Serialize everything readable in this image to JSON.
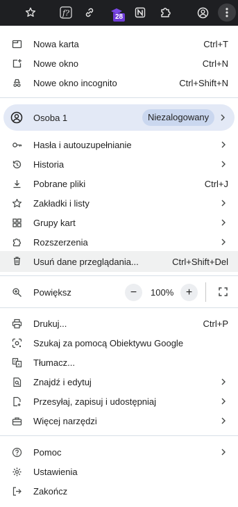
{
  "toolbar": {
    "badge": "28",
    "icons": [
      "star-icon",
      "font-extension-icon",
      "link-icon",
      "graduation-cap-icon",
      "notion-icon",
      "extensions-puzzle-icon",
      "profile-icon",
      "kebab-menu-icon"
    ]
  },
  "menu": {
    "new_tab": {
      "label": "Nowa karta",
      "shortcut": "Ctrl+T"
    },
    "new_window": {
      "label": "Nowe okno",
      "shortcut": "Ctrl+N"
    },
    "incognito": {
      "label": "Nowe okno incognito",
      "shortcut": "Ctrl+Shift+N"
    },
    "profile": {
      "label": "Osoba 1",
      "status": "Niezalogowany"
    },
    "passwords": {
      "label": "Hasła i autouzupełnianie"
    },
    "history": {
      "label": "Historia"
    },
    "downloads": {
      "label": "Pobrane pliki",
      "shortcut": "Ctrl+J"
    },
    "bookmarks": {
      "label": "Zakładki i listy"
    },
    "tab_groups": {
      "label": "Grupy kart"
    },
    "extensions": {
      "label": "Rozszerzenia"
    },
    "clear_data": {
      "label": "Usuń dane przeglądania...",
      "shortcut": "Ctrl+Shift+Del"
    },
    "zoom": {
      "label": "Powiększ",
      "minus": "−",
      "value": "100%",
      "plus": "+"
    },
    "print": {
      "label": "Drukuj...",
      "shortcut": "Ctrl+P"
    },
    "lens": {
      "label": "Szukaj za pomocą Obiektywu Google"
    },
    "translate": {
      "label": "Tłumacz..."
    },
    "find": {
      "label": "Znajdź i edytuj"
    },
    "cast": {
      "label": "Przesyłaj, zapisuj i udostępniaj"
    },
    "more_tools": {
      "label": "Więcej narzędzi"
    },
    "help": {
      "label": "Pomoc"
    },
    "settings": {
      "label": "Ustawienia"
    },
    "exit": {
      "label": "Zakończ"
    }
  },
  "colors": {
    "toolbar": "#1e1f22",
    "profile_bg": "#e3e9f6",
    "pill_bg": "#cad7ef",
    "badge": "#6f3bd8"
  }
}
